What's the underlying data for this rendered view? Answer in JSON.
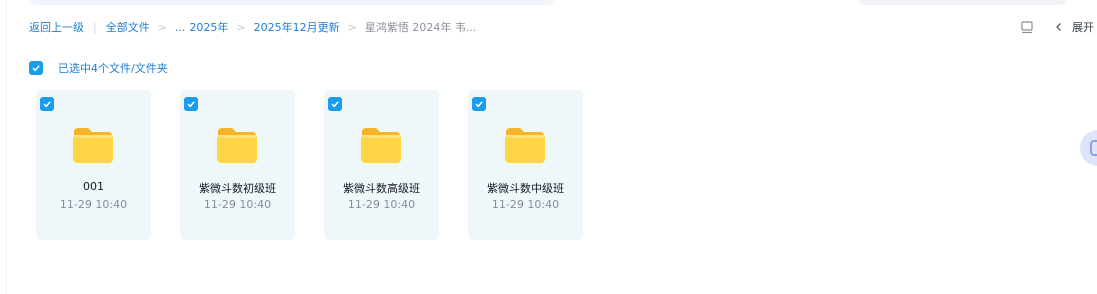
{
  "breadcrumb": {
    "back": "返回上一级",
    "all_files": "全部文件",
    "ellipsis": "...",
    "year": "2025年",
    "month": "2025年12月更新",
    "current": "星鸿紫悟 2024年 韦..."
  },
  "toolbar": {
    "expand_label": "展开",
    "view_icon": "list-view-icon",
    "chevron_icon": "chevron-left-icon"
  },
  "selection": {
    "label": "已选中4个文件/文件夹",
    "checked": true
  },
  "files": [
    {
      "name": "001",
      "time": "11-29 10:40",
      "checked": true,
      "type": "folder"
    },
    {
      "name": "紫微斗数初级班",
      "time": "11-29 10:40",
      "checked": true,
      "type": "folder"
    },
    {
      "name": "紫微斗数高级班",
      "time": "11-29 10:40",
      "checked": true,
      "type": "folder"
    },
    {
      "name": "紫微斗数中级班",
      "time": "11-29 10:40",
      "checked": true,
      "type": "folder"
    }
  ],
  "colors": {
    "accent": "#1a9cf0",
    "link": "#1f7ed6",
    "card_bg": "#eff7fb",
    "folder_yellow": "#ffcc33"
  }
}
